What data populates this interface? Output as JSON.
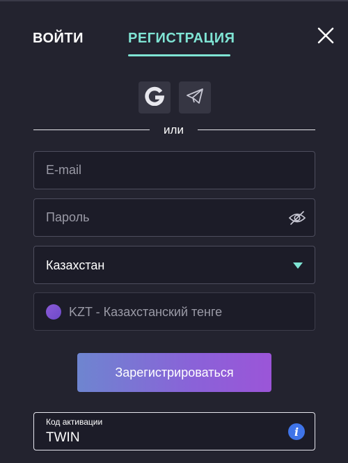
{
  "tabs": {
    "login": "ВОЙТИ",
    "register": "РЕГИСТРАЦИЯ",
    "active": "register"
  },
  "icons": {
    "close": "close-icon",
    "google": "google-icon",
    "telegram": "telegram-icon",
    "eye_off": "eye-off-icon",
    "caret": "chevron-down-icon",
    "info": "info-icon"
  },
  "divider": {
    "text": "или"
  },
  "form": {
    "email": {
      "placeholder": "E-mail",
      "value": ""
    },
    "password": {
      "placeholder": "Пароль",
      "value": ""
    },
    "country": {
      "value": "Казахстан"
    },
    "currency": {
      "value": "KZT - Казахстанский тенге"
    },
    "submit_label": "Зарегистрироваться",
    "activation": {
      "label": "Код активации",
      "value": "TWIN"
    }
  },
  "colors": {
    "accent": "#7fe4d4",
    "background": "#23232f",
    "button_gradient_start": "#6e85d0",
    "button_gradient_end": "#9b55d8",
    "info": "#3f74e8",
    "currency_dot": "#8a5ad8"
  }
}
